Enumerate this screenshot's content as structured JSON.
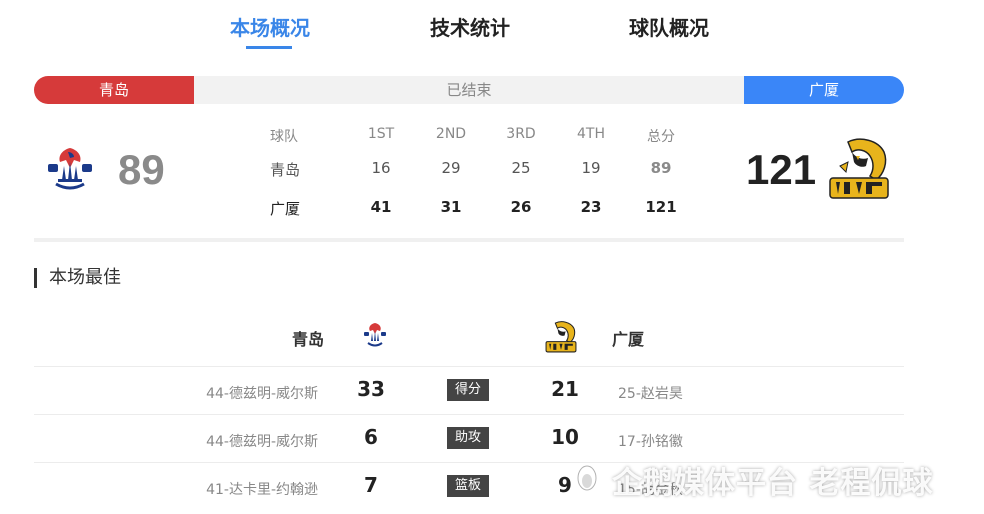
{
  "tabs": [
    {
      "label": "本场概况",
      "active": true
    },
    {
      "label": "技术统计",
      "active": false
    },
    {
      "label": "球队概况",
      "active": false
    }
  ],
  "status": {
    "home_team": "青岛",
    "state": "已结束",
    "away_team": "广厦"
  },
  "score": {
    "home": "89",
    "away": "121"
  },
  "quarters": {
    "headers": [
      "球队",
      "1ST",
      "2ND",
      "3RD",
      "4TH",
      "总分"
    ],
    "home": [
      "青岛",
      "16",
      "29",
      "25",
      "19",
      "89"
    ],
    "away": [
      "广厦",
      "41",
      "31",
      "26",
      "23",
      "121"
    ]
  },
  "best": {
    "title": "本场最佳",
    "home_team": "青岛",
    "away_team": "广厦",
    "rows": [
      {
        "home_player": "44-德兹明-威尔斯",
        "home_value": "33",
        "category": "得分",
        "away_value": "21",
        "away_player": "25-赵岩昊"
      },
      {
        "home_player": "44-德兹明-威尔斯",
        "home_value": "6",
        "category": "助攻",
        "away_value": "10",
        "away_player": "17-孙铭徽"
      },
      {
        "home_player": "41-达卡里-约翰逊",
        "home_value": "7",
        "category": "篮板",
        "away_value": "9",
        "away_player": "15-胡金秋"
      }
    ]
  },
  "watermark": {
    "text": "企鹅媒体平台 老程侃球"
  },
  "colors": {
    "accent": "#3a86e8",
    "home": "#d63a3a",
    "away": "#3a86f8"
  }
}
